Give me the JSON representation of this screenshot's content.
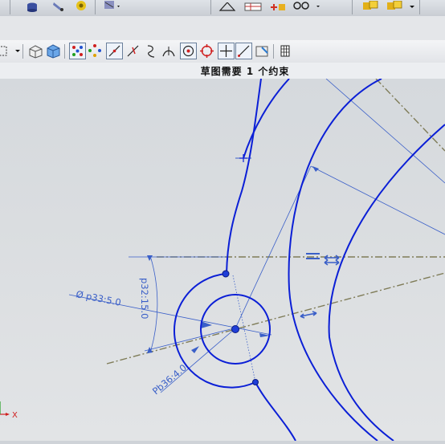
{
  "status": {
    "message": "草图需要 1 个约束"
  },
  "toolbar": {
    "top_icons": [
      "database-icon",
      "pen-icon",
      "lock-icon",
      "gear-icon",
      "triangle-icon",
      "table-icon",
      "grid-plus-icon",
      "glasses-icon",
      "box-left-icon",
      "box-right-icon"
    ],
    "sketch_icons": [
      "rectangle-select-icon",
      "box-wire-icon",
      "box-solid-icon",
      "snap-points-icon",
      "diamond-points-icon",
      "line-constraint-icon",
      "slope-icon",
      "curve-icon",
      "tangent-icon",
      "circle-center-icon",
      "target-icon",
      "crosshair-icon",
      "diagonal-icon",
      "camera-icon",
      "grid-icon"
    ]
  },
  "dimensions": {
    "diameter_label": "Ø p33:5.0",
    "radius_label": "p32:15.0",
    "offset_label": "Pb36:4.0"
  },
  "axes": {
    "x_label": "X"
  },
  "colors": {
    "sketch_curve": "#0b1fd6",
    "dimension": "#3a5fc8",
    "reference_line": "#8a8660",
    "background": "#d8dbdf"
  }
}
